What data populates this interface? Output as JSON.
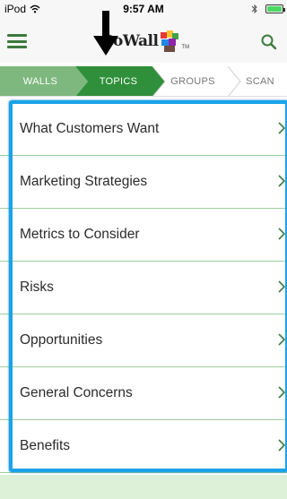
{
  "status": {
    "device": "iPod",
    "time": "9:57 AM"
  },
  "header": {
    "logo_text": "GoWall",
    "logo_tm": "TM"
  },
  "tabs": [
    {
      "label": "WALLS",
      "state": "completed"
    },
    {
      "label": "TOPICS",
      "state": "active"
    },
    {
      "label": "GROUPS",
      "state": "inactive"
    },
    {
      "label": "SCAN",
      "state": "inactive"
    }
  ],
  "topics": [
    {
      "label": "What Customers Want"
    },
    {
      "label": "Marketing Strategies"
    },
    {
      "label": "Metrics to Consider"
    },
    {
      "label": "Risks"
    },
    {
      "label": "Opportunities"
    },
    {
      "label": "General Concerns"
    },
    {
      "label": "Benefits"
    }
  ],
  "colors": {
    "accent_green": "#3d7a3d",
    "tab_green": "#5aa05a",
    "highlight_blue": "#1aa3e8",
    "divider": "#9ccf9c",
    "footer": "#ddf0d8"
  }
}
